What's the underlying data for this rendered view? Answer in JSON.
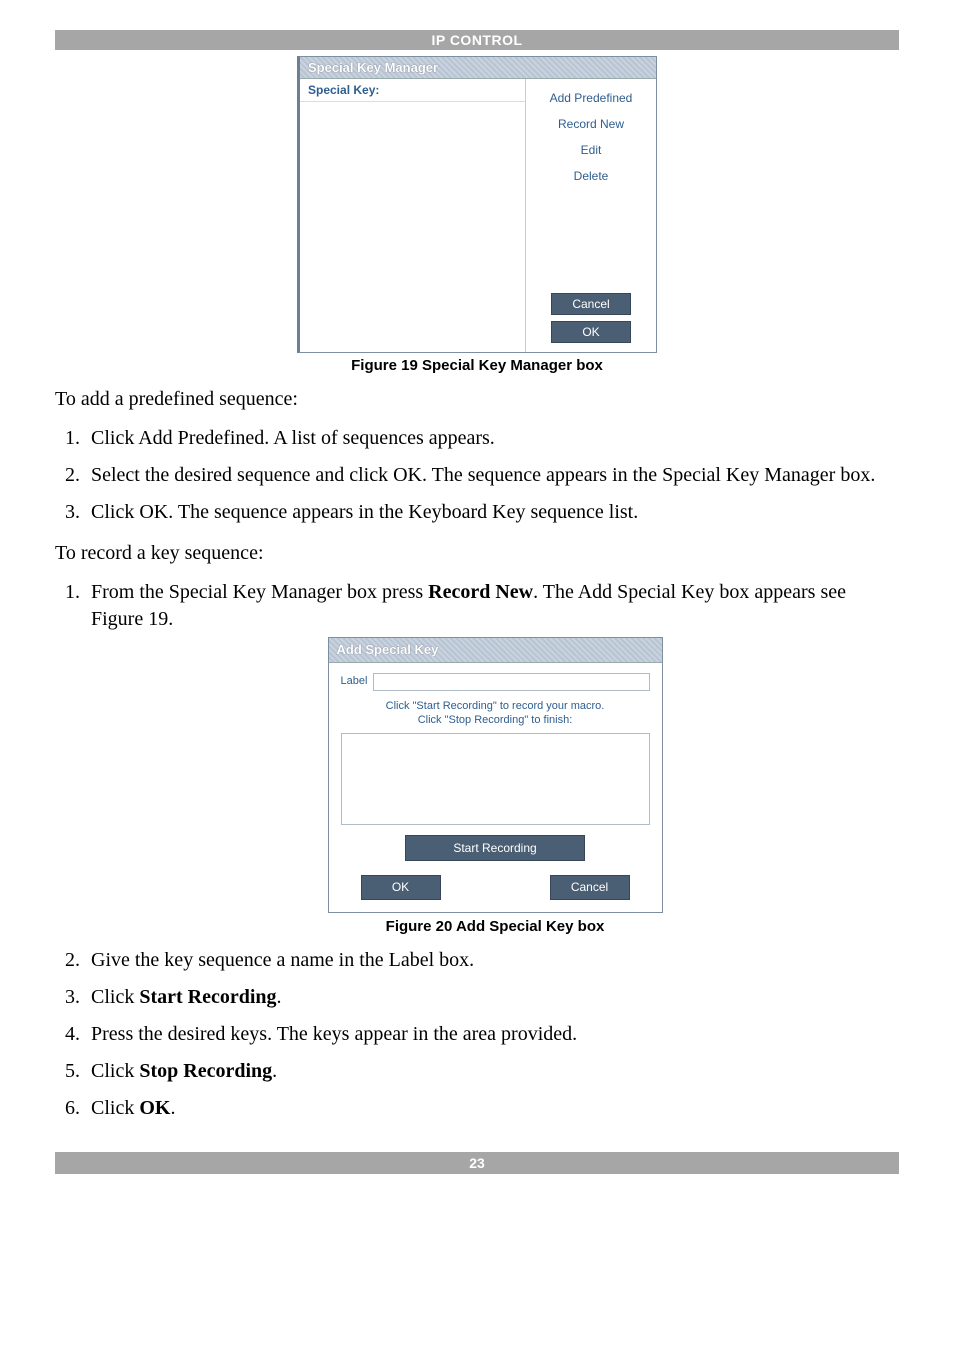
{
  "header": {
    "title": "IP CONTROL"
  },
  "footer": {
    "page": "23"
  },
  "figure19": {
    "dialogTitle": "Special Key Manager",
    "listHeader": "Special Key:",
    "links": {
      "addPredefined": "Add Predefined",
      "recordNew": "Record New",
      "edit": "Edit",
      "delete": "Delete"
    },
    "cancel": "Cancel",
    "ok": "OK",
    "caption": "Figure 19 Special Key Manager box"
  },
  "intro1": "To add a predefined sequence:",
  "steps1": [
    "Click Add Predefined. A list of sequences appears.",
    "Select the desired sequence and click OK. The sequence appears in the Special Key Manager box.",
    "Click OK. The sequence appears in the Keyboard Key sequence list."
  ],
  "intro2": "To record a key sequence:",
  "step2_1_pre": "From the Special Key Manager box press ",
  "step2_1_bold": "Record New",
  "step2_1_post": ". The Add Special Key box appears see Figure 19.",
  "figure20": {
    "dialogTitle": "Add Special Key",
    "label": "Label",
    "labelPlaceholder": "",
    "instr1": "Click \"Start Recording\" to record your macro.",
    "instr2": "Click \"Stop Recording\" to finish:",
    "startRecording": "Start Recording",
    "ok": "OK",
    "cancel": "Cancel",
    "caption": "Figure 20 Add Special Key box"
  },
  "steps2_rest": {
    "s2": "Give the key sequence a name in the Label box.",
    "s3_pre": "Click ",
    "s3_bold": "Start Recording",
    "s3_post": ".",
    "s4": "Press the desired keys. The keys appear in the area provided.",
    "s5_pre": "Click ",
    "s5_bold": "Stop Recording",
    "s5_post": ".",
    "s6_pre": "Click ",
    "s6_bold": "OK",
    "s6_post": "."
  }
}
